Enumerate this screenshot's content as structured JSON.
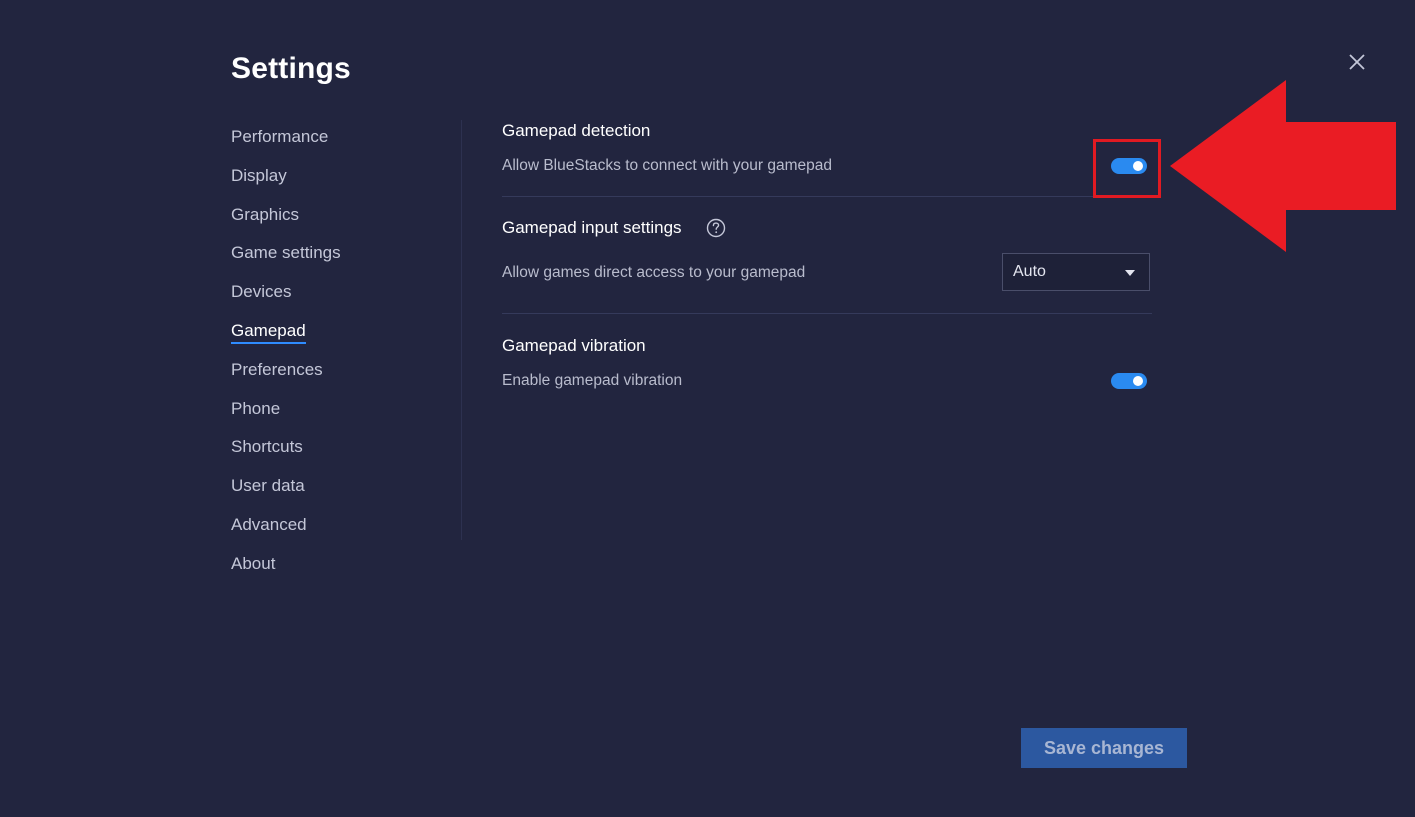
{
  "header": {
    "title": "Settings"
  },
  "sidebar": {
    "items": [
      {
        "label": "Performance",
        "active": false
      },
      {
        "label": "Display",
        "active": false
      },
      {
        "label": "Graphics",
        "active": false
      },
      {
        "label": "Game settings",
        "active": false
      },
      {
        "label": "Devices",
        "active": false
      },
      {
        "label": "Gamepad",
        "active": true
      },
      {
        "label": "Preferences",
        "active": false
      },
      {
        "label": "Phone",
        "active": false
      },
      {
        "label": "Shortcuts",
        "active": false
      },
      {
        "label": "User data",
        "active": false
      },
      {
        "label": "Advanced",
        "active": false
      },
      {
        "label": "About",
        "active": false
      }
    ]
  },
  "main": {
    "gamepad_detection": {
      "title": "Gamepad detection",
      "description": "Allow BlueStacks to connect with your gamepad",
      "enabled": true
    },
    "gamepad_input": {
      "title": "Gamepad input settings",
      "description": "Allow games direct access to your gamepad",
      "selected": "Auto"
    },
    "gamepad_vibration": {
      "title": "Gamepad vibration",
      "description": "Enable gamepad vibration",
      "enabled": true
    }
  },
  "footer": {
    "save_label": "Save changes"
  },
  "icons": {
    "close": "close-icon",
    "help": "help-icon",
    "dropdown": "chevron-down-icon",
    "annotation": "arrow-left-icon"
  },
  "colors": {
    "background": "#22253f",
    "accent": "#2a8af0",
    "annotation": "#e11a22",
    "button": "#2c58a0"
  }
}
